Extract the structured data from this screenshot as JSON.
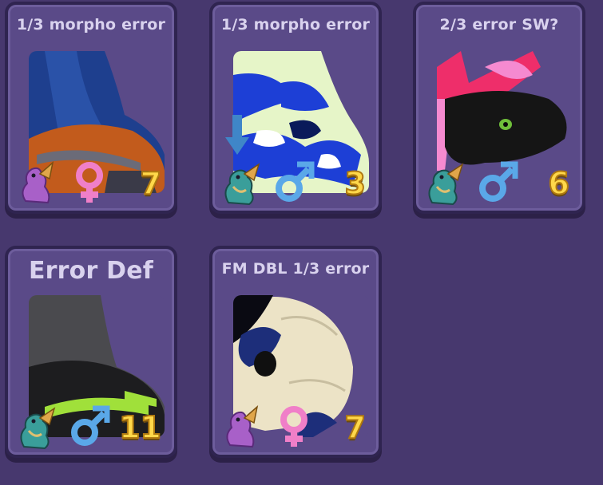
{
  "cards": [
    {
      "title": "1/3 morpho error",
      "age": "7",
      "gender": "female",
      "pet": "purple-dragon"
    },
    {
      "title": "1/3 morpho error",
      "age": "3",
      "gender": "male",
      "pet": "teal-dragon"
    },
    {
      "title": "2/3 error SW?",
      "age": "6",
      "gender": "male",
      "pet": "teal-dragon"
    },
    {
      "title": "Error Def",
      "age": "11",
      "gender": "male",
      "pet": "teal-dragon"
    },
    {
      "title": "FM DBL 1/3 error",
      "age": "7",
      "gender": "female",
      "pet": "purple-dragon"
    }
  ],
  "colors": {
    "background": "#47386e",
    "card": "#5a4a88",
    "age_text": "#ffd84a",
    "female": "#f07fc8",
    "male": "#5aa8e8"
  }
}
